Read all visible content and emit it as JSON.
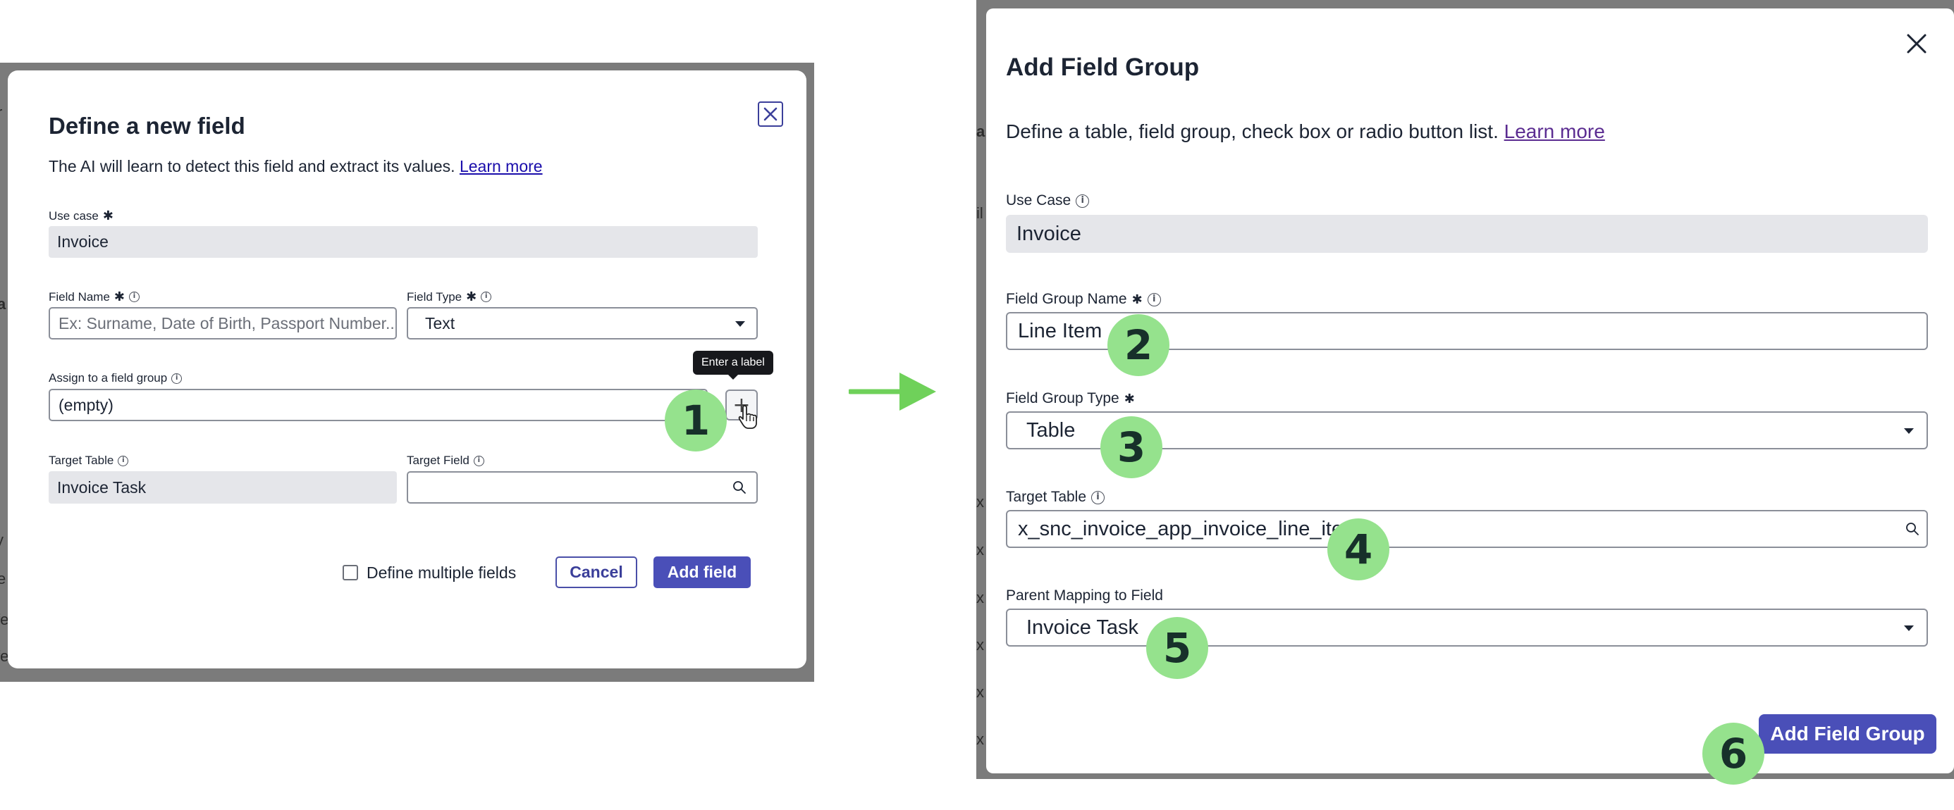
{
  "left_dialog": {
    "title": "Define a new field",
    "description": "The AI will learn to detect this field and extract its values.",
    "learn_more": "Learn more",
    "use_case": {
      "label": "Use case",
      "value": "Invoice"
    },
    "field_name": {
      "label": "Field Name",
      "placeholder": "Ex: Surname, Date of Birth, Passport Number.."
    },
    "field_type": {
      "label": "Field Type",
      "value": "Text"
    },
    "field_group": {
      "label": "Assign to a field group",
      "value": "(empty)"
    },
    "add_group_tooltip": "Enter a label",
    "target_table": {
      "label": "Target Table",
      "value": "Invoice Task"
    },
    "target_field": {
      "label": "Target Field",
      "value": ""
    },
    "multiple_fields_label": "Define multiple fields",
    "cancel": "Cancel",
    "add_field": "Add field",
    "background_letters": [
      "r",
      "a",
      "il",
      "a",
      "t",
      "i",
      "y",
      "e",
      "fe",
      "fe"
    ]
  },
  "right_dialog": {
    "title": "Add Field Group",
    "description": "Define a table, field group, check box or radio button list.",
    "learn_more": "Learn more",
    "use_case": {
      "label": "Use Case",
      "value": "Invoice"
    },
    "field_group_name": {
      "label": "Field Group Name",
      "value": "Line Item"
    },
    "field_group_type": {
      "label": "Field Group Type",
      "value": "Table"
    },
    "target_table": {
      "label": "Target Table",
      "value": "x_snc_invoice_app_invoice_line_item"
    },
    "parent_mapping": {
      "label": "Parent Mapping to Field",
      "value": "Invoice Task"
    },
    "add_field_group": "Add Field Group",
    "background_letters": [
      "a",
      "il",
      "x",
      "x",
      "x",
      "x",
      "x",
      "x",
      "i",
      "i"
    ]
  },
  "step_badges": [
    "1",
    "2",
    "3",
    "4",
    "5",
    "6"
  ],
  "colors": {
    "badge": "#95e28d",
    "arrow": "#6fd15a",
    "primary_button": "#4a4fb8",
    "link": "#1a0dab",
    "link_visited": "#5b2c91"
  }
}
